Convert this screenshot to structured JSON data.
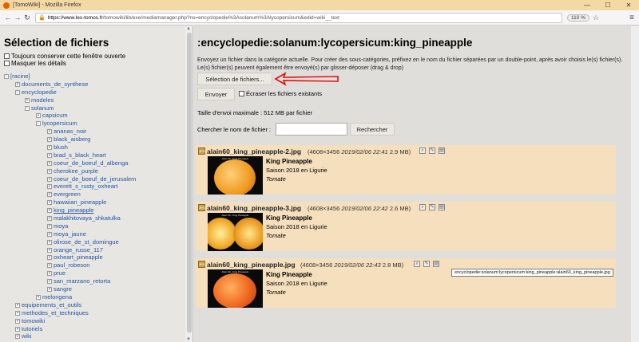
{
  "window": {
    "title": "[TomoWiki] - Mozilla Firefox",
    "min": "—",
    "max": "☐",
    "close": "✕"
  },
  "nav": {
    "back": "←",
    "forward": "→",
    "reload": "↻",
    "url_host": "https://www.les-tomos.fr",
    "url_path": "/tomowiki/lib/exe/mediamanager.php?ns=encyclopedie%3Asolanum%3Alycopersicum&edid=wiki__text",
    "zoom": "110 %",
    "star": "☆",
    "menu": "≡"
  },
  "sidebar": {
    "title": "Sélection de fichiers",
    "options": [
      "Toujours conserver cette fenêtre ouverte",
      "Masquer les détails"
    ],
    "tree": [
      {
        "label": "[racine]",
        "depth": 0,
        "toggle": "−"
      },
      {
        "label": "documents_de_synthese",
        "depth": 1,
        "toggle": "+"
      },
      {
        "label": "encyclopedie",
        "depth": 1,
        "toggle": "−"
      },
      {
        "label": "modeles",
        "depth": 2,
        "toggle": "+"
      },
      {
        "label": "solanum",
        "depth": 2,
        "toggle": "−"
      },
      {
        "label": "capsicum",
        "depth": 3,
        "toggle": "+"
      },
      {
        "label": "lycopersicum",
        "depth": 3,
        "toggle": "−"
      },
      {
        "label": "ananas_noir",
        "depth": 4,
        "toggle": "+"
      },
      {
        "label": "black_aisberg",
        "depth": 4,
        "toggle": "+"
      },
      {
        "label": "blush",
        "depth": 4,
        "toggle": "+"
      },
      {
        "label": "brad_s_black_heart",
        "depth": 4,
        "toggle": "+"
      },
      {
        "label": "coeur_de_boeuf_d_albenga",
        "depth": 4,
        "toggle": "+"
      },
      {
        "label": "cherokee_purple",
        "depth": 4,
        "toggle": "+"
      },
      {
        "label": "coeur_de_boeuf_de_jerusalem",
        "depth": 4,
        "toggle": "+"
      },
      {
        "label": "everett_s_rusty_oxheart",
        "depth": 4,
        "toggle": "+"
      },
      {
        "label": "evergreen",
        "depth": 4,
        "toggle": "+"
      },
      {
        "label": "hawaiian_pineapple",
        "depth": 4,
        "toggle": "+"
      },
      {
        "label": "king_pineapple",
        "depth": 4,
        "toggle": "+",
        "selected": true
      },
      {
        "label": "malakhitovaya_shkatulka",
        "depth": 4,
        "toggle": "+"
      },
      {
        "label": "moya",
        "depth": 4,
        "toggle": "+"
      },
      {
        "label": "moya_jaune",
        "depth": 4,
        "toggle": "+"
      },
      {
        "label": "olirose_de_st_domingue",
        "depth": 4,
        "toggle": "+"
      },
      {
        "label": "orange_russe_117",
        "depth": 4,
        "toggle": "+"
      },
      {
        "label": "oxheart_pineapple",
        "depth": 4,
        "toggle": "+"
      },
      {
        "label": "paul_robeson",
        "depth": 4,
        "toggle": "+"
      },
      {
        "label": "prue",
        "depth": 4,
        "toggle": "+"
      },
      {
        "label": "san_marzano_retorta",
        "depth": 4,
        "toggle": "+"
      },
      {
        "label": "sangre",
        "depth": 4,
        "toggle": "+"
      },
      {
        "label": "melongena",
        "depth": 3,
        "toggle": "+"
      },
      {
        "label": "equipements_et_outils",
        "depth": 1,
        "toggle": "+"
      },
      {
        "label": "methodes_et_techniques",
        "depth": 1,
        "toggle": "+"
      },
      {
        "label": "tomowiki",
        "depth": 1,
        "toggle": "+"
      },
      {
        "label": "tutoriels",
        "depth": 1,
        "toggle": "+"
      },
      {
        "label": "wiki",
        "depth": 1,
        "toggle": "+"
      }
    ]
  },
  "main": {
    "heading": ":encyclopedie:solanum:lycopersicum:king_pineapple",
    "intro": "Envoyez un fichier dans la catégorie actuelle. Pour créer des sous-catégories, préfixez en le nom du fichier séparées par un double-point, après avoir choisis le(s) fichier(s). Le(s) fichier(s) peuvent également être envoyé(s) par glisser-déposer (drag & drop)",
    "select_btn": "Sélection de fichiers...",
    "send_btn": "Envoyer",
    "overwrite": "Écraser les fichiers existants",
    "max_size": "Taille d'envoi maximale : 512 MB par fichier",
    "search_label": "Chercher le nom de fichier :",
    "search_value": "",
    "search_btn": "Rechercher",
    "files": [
      {
        "name": "alain60_king_pineapple-2.jpg",
        "dims": "(4608×3456",
        "date": "2019/02/06 22:41",
        "size": "2.9 MB)",
        "title": "King Pineapple",
        "season": "Saison 2018 en Ligurie",
        "sub": "Tomate",
        "thumb_caption": "Alain 60 - King Pineapple"
      },
      {
        "name": "alain60_king_pineapple-3.jpg",
        "dims": "(4608×3456",
        "date": "2019/02/06 22:42",
        "size": "2.6 MB)",
        "title": "King Pineapple",
        "season": "Saison 2018 en Ligurie",
        "sub": "Tomate",
        "thumb_caption": "Alain 60 - King Pineapple"
      },
      {
        "name": "alain60_king_pineapple.jpg",
        "dims": "(4608×3456",
        "date": "2019/02/06 22:43",
        "size": "2.8 MB)",
        "title": "King Pineapple",
        "season": "Saison 2018 en Ligurie",
        "sub": "Tomate",
        "thumb_caption": "Alain 60 - King Pineapple"
      }
    ],
    "tooltip": "encyclopedie:solanum:lycopersicum:king_pineapple:alain60_king_pineapple.jpg"
  },
  "colors": {
    "arrow": "#e01010",
    "link": "#2455a4",
    "file_bg": "#f5dfbd"
  }
}
